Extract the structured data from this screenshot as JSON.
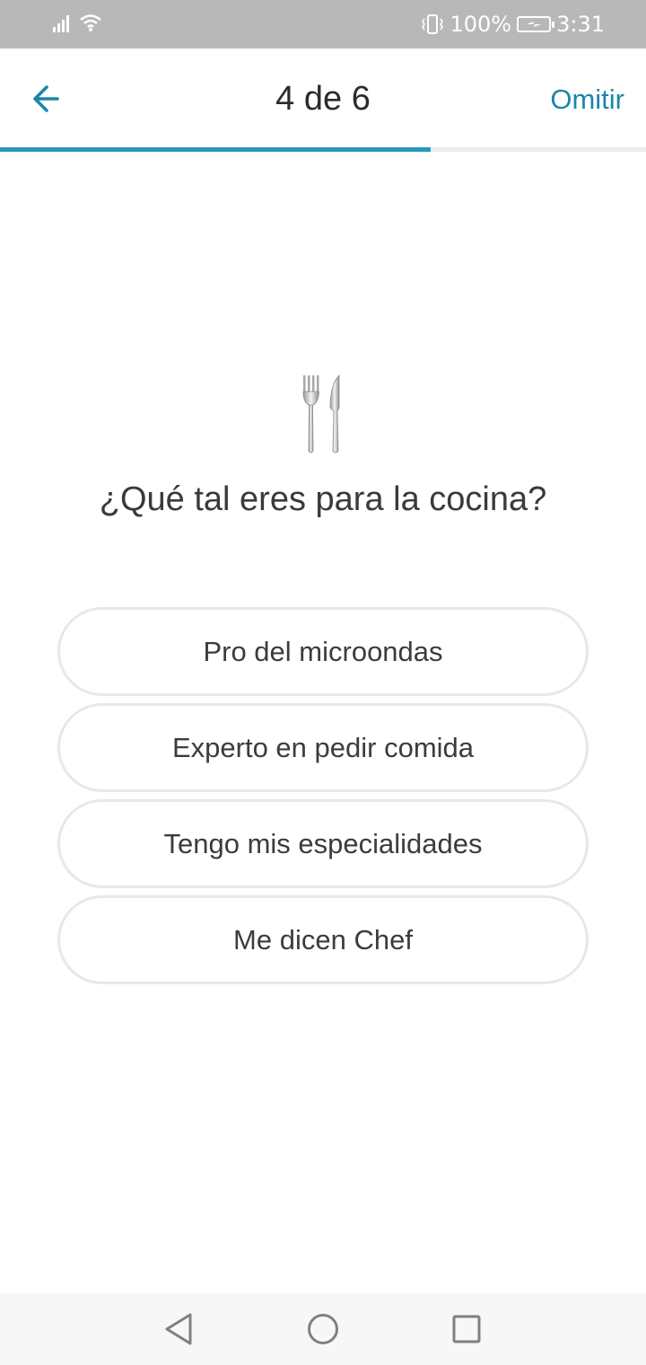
{
  "status_bar": {
    "battery_percent": "100%",
    "time": "3:31",
    "icons": [
      "signal-icon",
      "wifi-icon",
      "vibrate-icon",
      "battery-charging-icon"
    ]
  },
  "header": {
    "step_label": "4 de 6",
    "skip_label": "Omitir",
    "back_icon": "arrow-left-icon"
  },
  "progress": {
    "current": 4,
    "total": 6,
    "fraction": 0.6667
  },
  "question": {
    "icon": "fork-and-knife-icon",
    "text": "¿Qué tal eres para la cocina?"
  },
  "options": [
    {
      "label": "Pro del microondas"
    },
    {
      "label": "Experto en pedir comida"
    },
    {
      "label": "Tengo mis especialidades"
    },
    {
      "label": "Me dicen Chef"
    }
  ],
  "nav_bar": {
    "icons": [
      "nav-back-icon",
      "nav-home-icon",
      "nav-recents-icon"
    ]
  },
  "colors": {
    "accent": "#1b87a7",
    "progress": "#2a98b7",
    "status_bar": "#b8b8b8",
    "option_border": "#e8e8e8"
  }
}
